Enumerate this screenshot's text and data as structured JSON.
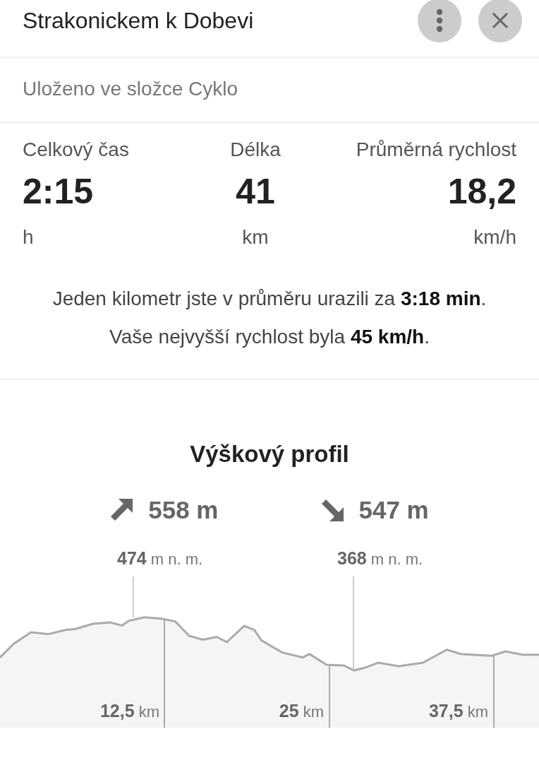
{
  "header": {
    "title": "Strakonickem k Dobevi"
  },
  "folder_note": "Uloženo ve složce Cyklo",
  "stats": [
    {
      "label": "Celkový čas",
      "value": "2:15",
      "unit": "h"
    },
    {
      "label": "Délka",
      "value": "41",
      "unit": "km"
    },
    {
      "label": "Průměrná rychlost",
      "value": "18,2",
      "unit": "km/h"
    }
  ],
  "summary": [
    "Jeden kilometr jste v průměru urazili za **3:18 min**.",
    "Vaše nejvyšší rychlost byla **45 km/h**."
  ],
  "elevation": {
    "title": "Výškový profil",
    "totals": [
      {
        "kind": "ascent",
        "value": "558 m"
      },
      {
        "kind": "descent",
        "value": "547 m"
      }
    ],
    "max_label": "**474** m n. m.",
    "min_label": "**368** m n. m.",
    "distance_labels": [
      "**12,5** km",
      "**25** km",
      "**37,5** km"
    ]
  }
}
